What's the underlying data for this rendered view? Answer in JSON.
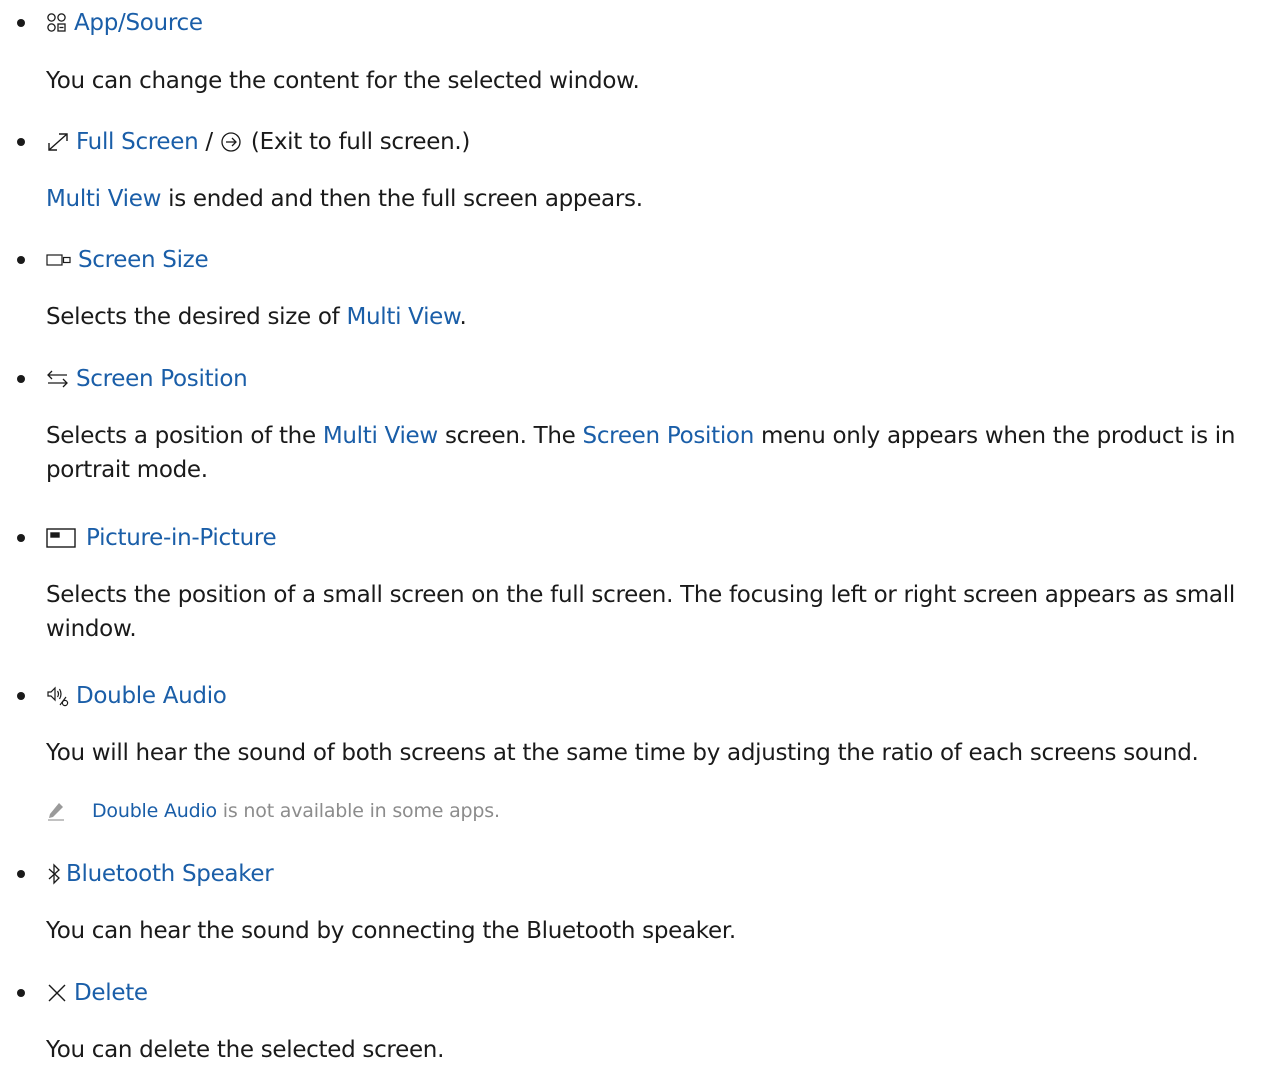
{
  "items": [
    {
      "label": "App/Source",
      "icon": "app-source-icon",
      "desc": "You can change the content for the selected window."
    },
    {
      "label": "Full Screen",
      "icon": "full-screen-icon",
      "sep": " / ",
      "icon2": "exit-full-screen-icon",
      "suffix": " (Exit to full screen.)",
      "desc_parts": [
        "Multi View",
        " is ended and then the full screen appears."
      ]
    },
    {
      "label": "Screen Size",
      "icon": "screen-size-icon",
      "desc_parts": [
        "Selects the desired size of ",
        "Multi View",
        "."
      ]
    },
    {
      "label": "Screen Position",
      "icon": "screen-position-icon",
      "desc_parts": [
        "Selects a position of the ",
        "Multi View",
        " screen. The ",
        "Screen Position",
        " menu only appears when the product is in portrait mode."
      ]
    },
    {
      "label": "Picture-in-Picture",
      "icon": "picture-in-picture-icon",
      "desc": "Selects the position of a small screen on the full screen. The focusing left or right screen appears as small window."
    },
    {
      "label": "Double Audio",
      "icon": "double-audio-icon",
      "desc": "You will hear the sound of both screens at the same time by adjusting the ratio of each screens sound.",
      "note_parts": [
        "Double Audio",
        " is not available in some apps."
      ]
    },
    {
      "label": "Bluetooth Speaker",
      "icon": "bluetooth-icon",
      "desc": "You can hear the sound by connecting the Bluetooth speaker."
    },
    {
      "label": "Delete",
      "icon": "delete-icon",
      "desc": "You can delete the selected screen."
    }
  ],
  "colors": {
    "link": "#1a5ea8",
    "text": "#1a1a1a",
    "note": "#8c8c8c"
  }
}
